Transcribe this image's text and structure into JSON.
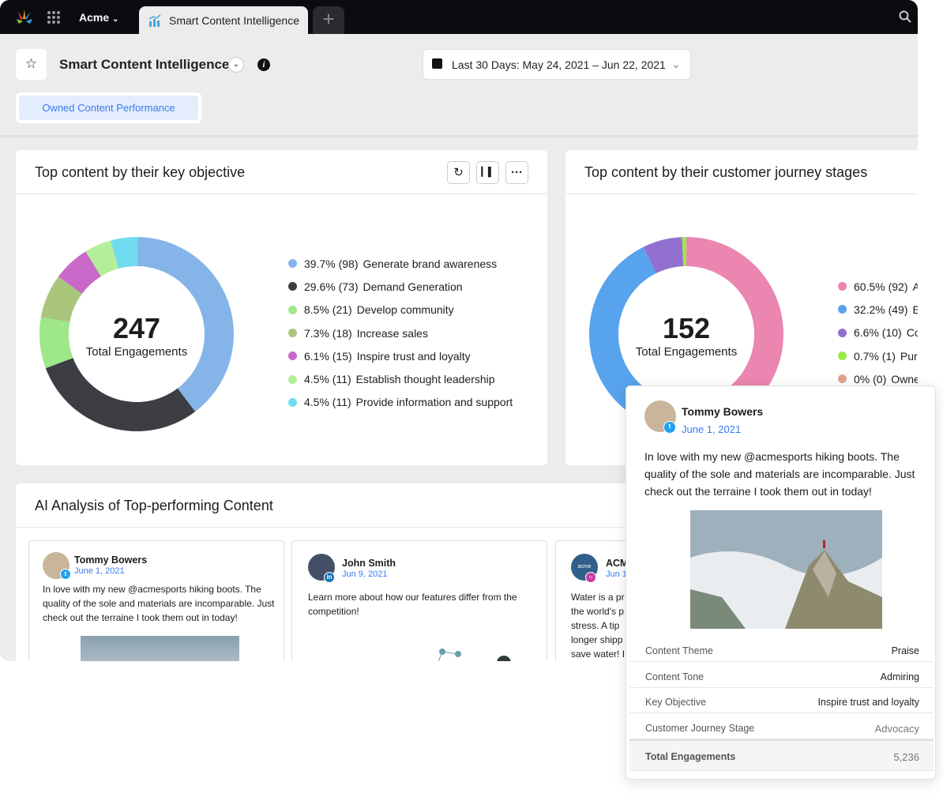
{
  "topbar": {
    "workspace": "Acme",
    "tab": "Smart Content Intelligence",
    "new_tab": "+"
  },
  "header": {
    "title": "Smart Content Intelligence",
    "date_range": "Last 30 Days: May 24, 2021 – Jun 22, 2021",
    "view_tab": "Owned Content Performance"
  },
  "objective_card": {
    "title": "Top content by their key objective",
    "total": "247",
    "total_label": "Total Engagements"
  },
  "journey_card": {
    "title": "Top content by their customer journey stages",
    "total": "152",
    "total_label": "Total Engagements"
  },
  "ai_card": {
    "title": "AI Analysis of Top-performing Content"
  },
  "chart_data": [
    {
      "type": "pie",
      "title": "Top content by their key objective",
      "donut": true,
      "total": 247,
      "series": [
        {
          "name": "Generate brand awareness",
          "label": "39.7% (98)",
          "percent": 39.7,
          "value": 98,
          "color": "#85b4e8"
        },
        {
          "name": "Demand Generation",
          "label": "29.6% (73)",
          "percent": 29.6,
          "value": 73,
          "color": "#3d3e44"
        },
        {
          "name": "Develop community",
          "label": "8.5% (21)",
          "percent": 8.5,
          "value": 21,
          "color": "#9ee88a"
        },
        {
          "name": "Increase sales",
          "label": "7.3% (18)",
          "percent": 7.3,
          "value": 18,
          "color": "#a9c67c"
        },
        {
          "name": "Inspire trust and loyalty",
          "label": "6.1% (15)",
          "percent": 6.1,
          "value": 15,
          "color": "#c869c9"
        },
        {
          "name": "Establish thought leadership",
          "label": "4.5% (11)",
          "percent": 4.5,
          "value": 11,
          "color": "#b5ee9a"
        },
        {
          "name": "Provide information and support",
          "label": "4.5% (11)",
          "percent": 4.5,
          "value": 11,
          "color": "#6fdcf0"
        }
      ]
    },
    {
      "type": "pie",
      "title": "Top content by their customer journey stages",
      "donut": true,
      "total": 152,
      "series": [
        {
          "name": "A",
          "label": "60.5% (92)",
          "percent": 60.5,
          "value": 92,
          "color": "#ea86b0"
        },
        {
          "name": "E",
          "label": "32.2% (49)",
          "percent": 32.2,
          "value": 49,
          "color": "#58a3ee"
        },
        {
          "name": "Co",
          "label": "6.6% (10)",
          "percent": 6.6,
          "value": 10,
          "color": "#9170cf"
        },
        {
          "name": "Purc",
          "label": "0.7% (1)",
          "percent": 0.7,
          "value": 1,
          "color": "#9de84a"
        },
        {
          "name": "Owne",
          "label": "0% (0)",
          "percent": 0,
          "value": 0,
          "color": "#e0a48e"
        }
      ]
    }
  ],
  "posts": [
    {
      "author": "Tommy Bowers",
      "date": "June 1, 2021",
      "network": "twitter",
      "text": "In love with my new @acmesports hiking boots. The quality of the sole and materials are incomparable. Just check out the terraine I took them out in today!"
    },
    {
      "author": "John Smith",
      "date": "Jun 9, 2021",
      "network": "linkedin",
      "text": "Learn more about how our features differ from the competition!"
    },
    {
      "author": "ACM",
      "date": "Jun 1",
      "network": "instagram",
      "avatar_text": "acme",
      "text": "Water is a pr the world's p stress. A tip longer shipp save water! I"
    }
  ],
  "popup": {
    "author": "Tommy Bowers",
    "date": "June 1, 2021",
    "text": "In love with my new @acmesports hiking boots. The quality of the sole and materials are incomparable. Just check out the terraine I took them out in today!",
    "rows": [
      {
        "label": "Content Theme",
        "value": "Praise"
      },
      {
        "label": "Content Tone",
        "value": "Admiring"
      },
      {
        "label": "Key Objective",
        "value": "Inspire trust and loyalty"
      },
      {
        "label": "Customer Journey Stage",
        "value": "Advocacy"
      },
      {
        "label": "Total Engagements",
        "value": "5,236"
      }
    ]
  }
}
